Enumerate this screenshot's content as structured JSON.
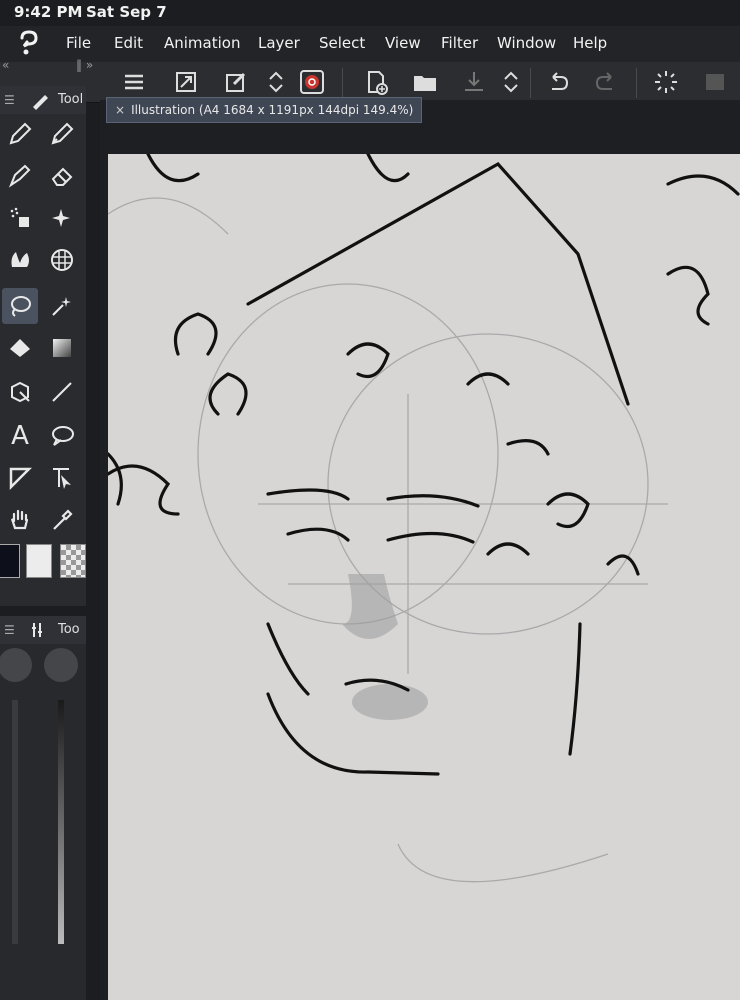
{
  "status_bar": {
    "time": "9:42 PM",
    "date": "Sat Sep 7"
  },
  "menu": {
    "file": "File",
    "edit": "Edit",
    "animation": "Animation",
    "layer": "Layer",
    "select": "Select",
    "view": "View",
    "filter": "Filter",
    "window": "Window",
    "help": "Help"
  },
  "tool_panel": {
    "title": "Tool"
  },
  "sub_tool_panel": {
    "title": "Too"
  },
  "document": {
    "tab_label": "Illustration (A4 1684 x 1191px 144dpi 149.4%)"
  },
  "colors": {
    "accent": "#4a5260",
    "background": "#1c1d20",
    "paper": "#d8d6d4",
    "main_color": "#0d0f1a",
    "sub_color": "#ececec"
  },
  "icons": [
    "app-logo-icon",
    "menu-icon",
    "transform-icon",
    "edit-icon",
    "chevron-updown-icon",
    "color-icon",
    "new-icon",
    "open-icon",
    "save-icon",
    "undo-icon",
    "redo-icon",
    "loading-icon"
  ]
}
